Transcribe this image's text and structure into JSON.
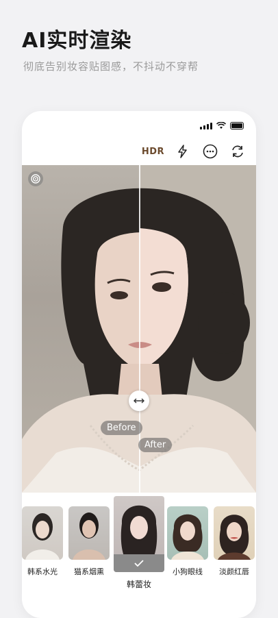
{
  "header": {
    "title": "AI实时渲染",
    "subtitle": "彻底告别妆容贴图感，不抖动不穿帮"
  },
  "toolbar": {
    "hdr_label": "HDR",
    "icons": [
      "flash-auto-icon",
      "more-icon",
      "switch-camera-icon"
    ]
  },
  "compare": {
    "before_label": "Before",
    "after_label": "After"
  },
  "styles": [
    {
      "label": "韩系水光",
      "selected": false
    },
    {
      "label": "猫系烟熏",
      "selected": false
    },
    {
      "label": "韩蕾妆",
      "selected": true
    },
    {
      "label": "小狗眼线",
      "selected": false
    },
    {
      "label": "淡颜红唇",
      "selected": false
    }
  ],
  "colors": {
    "hdr": "#6b4a2d",
    "page_bg": "#f2f2f4",
    "selected_overlay": "#8a8a8a"
  }
}
